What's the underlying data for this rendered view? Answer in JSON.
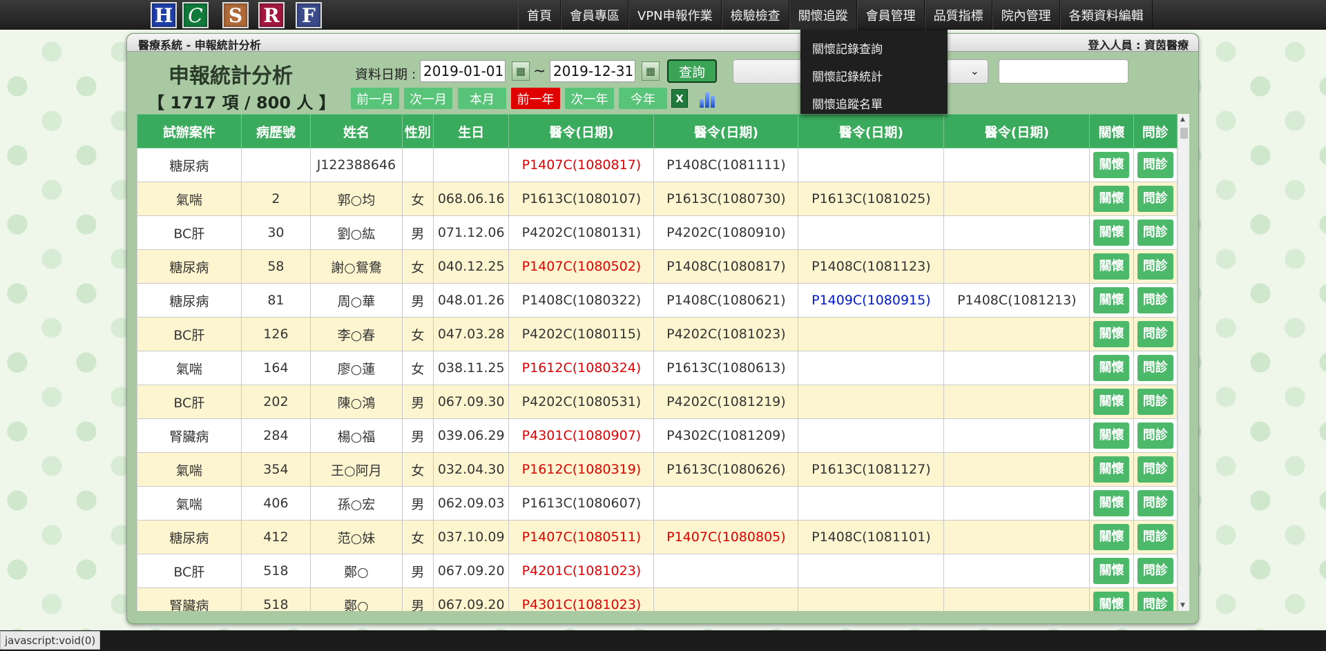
{
  "logos": [
    {
      "letter": "H",
      "color": "#1e3fa8"
    },
    {
      "letter": "C",
      "color": "#0f7a3a"
    },
    {
      "letter": "S",
      "color": "#b06a3a"
    },
    {
      "letter": "R",
      "color": "#a3173f"
    },
    {
      "letter": "F",
      "color": "#3a4a8a"
    }
  ],
  "nav": [
    "首頁",
    "會員專區",
    "VPN申報作業",
    "檢驗檢查",
    "關懷追蹤",
    "會員管理",
    "品質指標",
    "院內管理",
    "各類資料編輯"
  ],
  "dropdown": [
    "關懷記錄查詢",
    "關懷記錄統計",
    "關懷追蹤名單"
  ],
  "panel": {
    "title": "醫療系統 - 申報統計分析",
    "login": "登入人員 : 資茵醫療"
  },
  "page": {
    "title": "申報統計分析",
    "count": "【 1717 項 / 800 人 】",
    "date_label": "資料日期 :",
    "date_from": "2019-01-01",
    "date_to": "2019-12-31",
    "tilde": "~",
    "query": "查詢"
  },
  "quick_buttons": [
    "前一月",
    "次一月",
    "本月",
    "前一年",
    "次一年",
    "今年"
  ],
  "table": {
    "headers": [
      "試辦案件",
      "病歷號",
      "姓名",
      "性別",
      "生日",
      "醫令(日期)",
      "醫令(日期)",
      "醫令(日期)",
      "醫令(日期)",
      "關懷",
      "問診"
    ],
    "action_labels": [
      "關懷",
      "問診"
    ],
    "rows": [
      {
        "case": "糖尿病",
        "id": "",
        "name": "J122388646",
        "sex": "",
        "birth": "",
        "o1": "P1407C(1080817)",
        "o1c": "red",
        "o2": "P1408C(1081111)",
        "o2c": "",
        "o3": "",
        "o3c": "",
        "o4": "",
        "o4c": ""
      },
      {
        "case": "氣喘",
        "id": "2",
        "name": "郭○均",
        "sex": "女",
        "birth": "068.06.16",
        "o1": "P1613C(1080107)",
        "o1c": "",
        "o2": "P1613C(1080730)",
        "o2c": "",
        "o3": "P1613C(1081025)",
        "o3c": "",
        "o4": "",
        "o4c": ""
      },
      {
        "case": "BC肝",
        "id": "30",
        "name": "劉○紘",
        "sex": "男",
        "birth": "071.12.06",
        "o1": "P4202C(1080131)",
        "o1c": "",
        "o2": "P4202C(1080910)",
        "o2c": "",
        "o3": "",
        "o3c": "",
        "o4": "",
        "o4c": ""
      },
      {
        "case": "糖尿病",
        "id": "58",
        "name": "謝○鴛鴦",
        "sex": "女",
        "birth": "040.12.25",
        "o1": "P1407C(1080502)",
        "o1c": "red",
        "o2": "P1408C(1080817)",
        "o2c": "",
        "o3": "P1408C(1081123)",
        "o3c": "",
        "o4": "",
        "o4c": ""
      },
      {
        "case": "糖尿病",
        "id": "81",
        "name": "周○華",
        "sex": "男",
        "birth": "048.01.26",
        "o1": "P1408C(1080322)",
        "o1c": "",
        "o2": "P1408C(1080621)",
        "o2c": "",
        "o3": "P1409C(1080915)",
        "o3c": "blue",
        "o4": "P1408C(1081213)",
        "o4c": ""
      },
      {
        "case": "BC肝",
        "id": "126",
        "name": "李○春",
        "sex": "女",
        "birth": "047.03.28",
        "o1": "P4202C(1080115)",
        "o1c": "",
        "o2": "P4202C(1081023)",
        "o2c": "",
        "o3": "",
        "o3c": "",
        "o4": "",
        "o4c": ""
      },
      {
        "case": "氣喘",
        "id": "164",
        "name": "廖○蓮",
        "sex": "女",
        "birth": "038.11.25",
        "o1": "P1612C(1080324)",
        "o1c": "red",
        "o2": "P1613C(1080613)",
        "o2c": "",
        "o3": "",
        "o3c": "",
        "o4": "",
        "o4c": ""
      },
      {
        "case": "BC肝",
        "id": "202",
        "name": "陳○鴻",
        "sex": "男",
        "birth": "067.09.30",
        "o1": "P4202C(1080531)",
        "o1c": "",
        "o2": "P4202C(1081219)",
        "o2c": "",
        "o3": "",
        "o3c": "",
        "o4": "",
        "o4c": ""
      },
      {
        "case": "腎臟病",
        "id": "284",
        "name": "楊○福",
        "sex": "男",
        "birth": "039.06.29",
        "o1": "P4301C(1080907)",
        "o1c": "red",
        "o2": "P4302C(1081209)",
        "o2c": "",
        "o3": "",
        "o3c": "",
        "o4": "",
        "o4c": ""
      },
      {
        "case": "氣喘",
        "id": "354",
        "name": "王○阿月",
        "sex": "女",
        "birth": "032.04.30",
        "o1": "P1612C(1080319)",
        "o1c": "red",
        "o2": "P1613C(1080626)",
        "o2c": "",
        "o3": "P1613C(1081127)",
        "o3c": "",
        "o4": "",
        "o4c": ""
      },
      {
        "case": "氣喘",
        "id": "406",
        "name": "孫○宏",
        "sex": "男",
        "birth": "062.09.03",
        "o1": "P1613C(1080607)",
        "o1c": "",
        "o2": "",
        "o2c": "",
        "o3": "",
        "o3c": "",
        "o4": "",
        "o4c": ""
      },
      {
        "case": "糖尿病",
        "id": "412",
        "name": "范○妹",
        "sex": "女",
        "birth": "037.10.09",
        "o1": "P1407C(1080511)",
        "o1c": "red",
        "o2": "P1407C(1080805)",
        "o2c": "red",
        "o3": "P1408C(1081101)",
        "o3c": "",
        "o4": "",
        "o4c": ""
      },
      {
        "case": "BC肝",
        "id": "518",
        "name": "鄭○",
        "sex": "男",
        "birth": "067.09.20",
        "o1": "P4201C(1081023)",
        "o1c": "red",
        "o2": "",
        "o2c": "",
        "o3": "",
        "o3c": "",
        "o4": "",
        "o4c": ""
      },
      {
        "case": "腎臟病",
        "id": "518",
        "name": "鄭○",
        "sex": "男",
        "birth": "067.09.20",
        "o1": "P4301C(1081023)",
        "o1c": "red",
        "o2": "",
        "o2c": "",
        "o3": "",
        "o3c": "",
        "o4": "",
        "o4c": ""
      }
    ]
  },
  "status_bar": "javascript:void(0)"
}
